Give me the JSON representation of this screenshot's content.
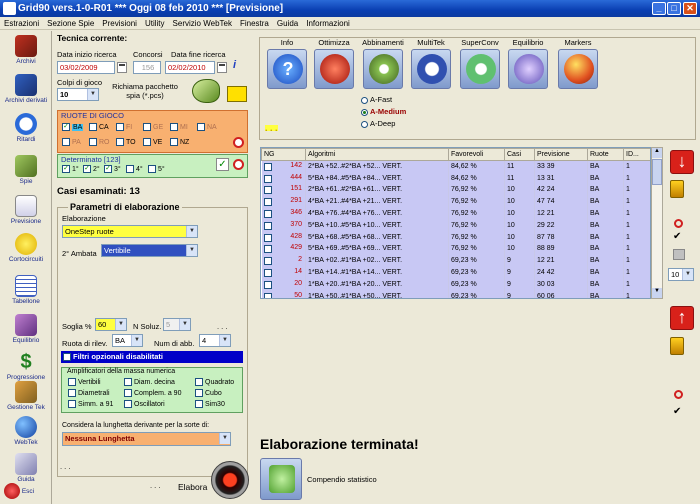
{
  "window": {
    "title": "Grid90 vers.1-0-R01   ***  Oggi 08 feb 2010   ***   [Previsione]"
  },
  "menu": [
    "Estrazioni",
    "Sezione Spie",
    "Previsioni",
    "Utility",
    "Servizio WebTek",
    "Finestra",
    "Guida",
    "Informazioni"
  ],
  "sidebar": [
    {
      "label": "Archivi",
      "icon": "book-icon"
    },
    {
      "label": "Archivi derivati",
      "icon": "book-stack-icon"
    },
    {
      "label": "Ritardi",
      "icon": "clock-icon"
    },
    {
      "label": "Spie",
      "icon": "flashlight-icon"
    },
    {
      "label": "Previsione",
      "icon": "checklist-icon"
    },
    {
      "label": "Cortocircuiti",
      "icon": "lightbulb-icon"
    },
    {
      "label": "Tabellone",
      "icon": "calendar-icon"
    },
    {
      "label": "Equilibrio",
      "icon": "scales-icon"
    },
    {
      "label": "Progressione",
      "icon": "dollar-icon"
    },
    {
      "label": "Gestione Tek",
      "icon": "tools-icon"
    },
    {
      "label": "WebTek",
      "icon": "globe-icon"
    },
    {
      "label": "Guida",
      "icon": "pencil-book-icon"
    },
    {
      "label": "Esci",
      "icon": "exit-icon"
    }
  ],
  "left": {
    "tecnica_title": "Tecnica corrente:",
    "data_inizio_label": "Data inizio ricerca",
    "data_inizio": "03/02/2009",
    "concorsi_label": "Concorsi",
    "concorsi": "156",
    "data_fine_label": "Data fine ricerca",
    "data_fine": "02/02/2010",
    "colpi_label": "Colpi di gioco",
    "colpi": "10",
    "richiama_label": "Richiama pacchetto spia (*.pcs)",
    "ruote_title": "RUOTE DI GIOCO",
    "ruote_row1": [
      "BA",
      "CA",
      "FI",
      "GE",
      "MI",
      "NA"
    ],
    "ruote_row2": [
      "PA",
      "RO",
      "TO",
      "VE",
      "NZ"
    ],
    "determinato_label": "Determinato [123]",
    "determinato_items": [
      "1°",
      "2°",
      "3°",
      "4°",
      "5°"
    ],
    "casi_esaminati": "Casi esaminati: 13",
    "parametri_title": "Parametri di elaborazione",
    "elaborazione_label": "Elaborazione",
    "elaborazione_value": "OneStep ruote",
    "ambata_label": "2° Ambata",
    "ambata_value": "Vertibile",
    "soglia_label": "Soglia %",
    "soglia_value": "60",
    "nsoluz_label": "N Soluz.",
    "nsoluz_value": "5",
    "ruota_rilev_label": "Ruota di rilev.",
    "ruota_rilev_value": "BA",
    "num_abb_label": "Num di abb.",
    "num_abb_value": "4",
    "filtri_label": "Filtri opzionali disabilitati",
    "amplificatori_title": "Amplificatori della massa numerica",
    "amplificatori": [
      [
        "Vertibili",
        "Diam. decina",
        "Quadrato"
      ],
      [
        "Diametrali",
        "Complem. a 90",
        "Cubo"
      ],
      [
        "Simm. a 91",
        "Oscillatori",
        "Sim30"
      ]
    ],
    "lunghetta_label": "Considera la lunghetta derivante per la sorte di:",
    "lunghetta_value": "Nessuna Lunghetta",
    "elabora_label": "Elabora",
    "ellipsis": ". . ."
  },
  "tools": [
    {
      "label": "Info",
      "color": "#2a6ad8",
      "icon": "question-icon"
    },
    {
      "label": "Ottimizza",
      "color": "#c02010",
      "icon": "flame-icon"
    },
    {
      "label": "Abbinamenti",
      "color": "#78b040",
      "icon": "gear-icon"
    },
    {
      "label": "MultiTek",
      "color": "#3a5ab0",
      "icon": "swirl-icon"
    },
    {
      "label": "SuperConv",
      "color": "#58c070",
      "icon": "recycle-icon"
    },
    {
      "label": "Equilibrio",
      "color": "#7a68c8",
      "icon": "cluster-icon"
    },
    {
      "label": "Markers",
      "color": "#e06030",
      "icon": "ball-icon"
    }
  ],
  "algo_options": [
    "A-Fast",
    "A-Medium",
    "A-Deep"
  ],
  "algo_selected": "A-Medium",
  "grid": {
    "headers": [
      "NG",
      "Algoritmi",
      "Favorevoli",
      "Casi",
      "Previsione",
      "Ruote",
      "ID..."
    ],
    "rows": [
      [
        "142",
        "2*BA +52..#2*BA +52... VERT.",
        "84,62 %",
        "11",
        "33 39",
        "BA",
        "1"
      ],
      [
        "444",
        "5*BA +84..#5*BA +84... VERT.",
        "84,62 %",
        "11",
        "13 31",
        "BA",
        "1"
      ],
      [
        "151",
        "2*BA +61..#2*BA +61... VERT.",
        "76,92 %",
        "10",
        "42 24",
        "BA",
        "1"
      ],
      [
        "291",
        "4*BA +21..#4*BA +21... VERT.",
        "76,92 %",
        "10",
        "47 74",
        "BA",
        "1"
      ],
      [
        "346",
        "4*BA +76..#4*BA +76... VERT.",
        "76,92 %",
        "10",
        "12 21",
        "BA",
        "1"
      ],
      [
        "370",
        "5*BA +10..#5*BA +10... VERT.",
        "76,92 %",
        "10",
        "29 22",
        "BA",
        "1"
      ],
      [
        "428",
        "5*BA +68..#5*BA +68... VERT.",
        "76,92 %",
        "10",
        "87 78",
        "BA",
        "1"
      ],
      [
        "429",
        "5*BA +69..#5*BA +69... VERT.",
        "76,92 %",
        "10",
        "88 89",
        "BA",
        "1"
      ],
      [
        "2",
        "1*BA +02..#1*BA +02... VERT.",
        "69,23 %",
        "9",
        "12 21",
        "BA",
        "1"
      ],
      [
        "14",
        "1*BA +14..#1*BA +14... VERT.",
        "69,23 %",
        "9",
        "24 42",
        "BA",
        "1"
      ],
      [
        "20",
        "1*BA +20..#1*BA +20... VERT.",
        "69,23 %",
        "9",
        "30 03",
        "BA",
        "1"
      ],
      [
        "50",
        "1*BA +50..#1*BA +50... VERT.",
        "69,23 %",
        "9",
        "60 06",
        "BA",
        "1"
      ]
    ]
  },
  "status_text": "Elaborazione terminata!",
  "compendio_label": "Compendio statistico",
  "right_side": {
    "zoom_value": "10"
  },
  "ellipsis2": ". . ."
}
